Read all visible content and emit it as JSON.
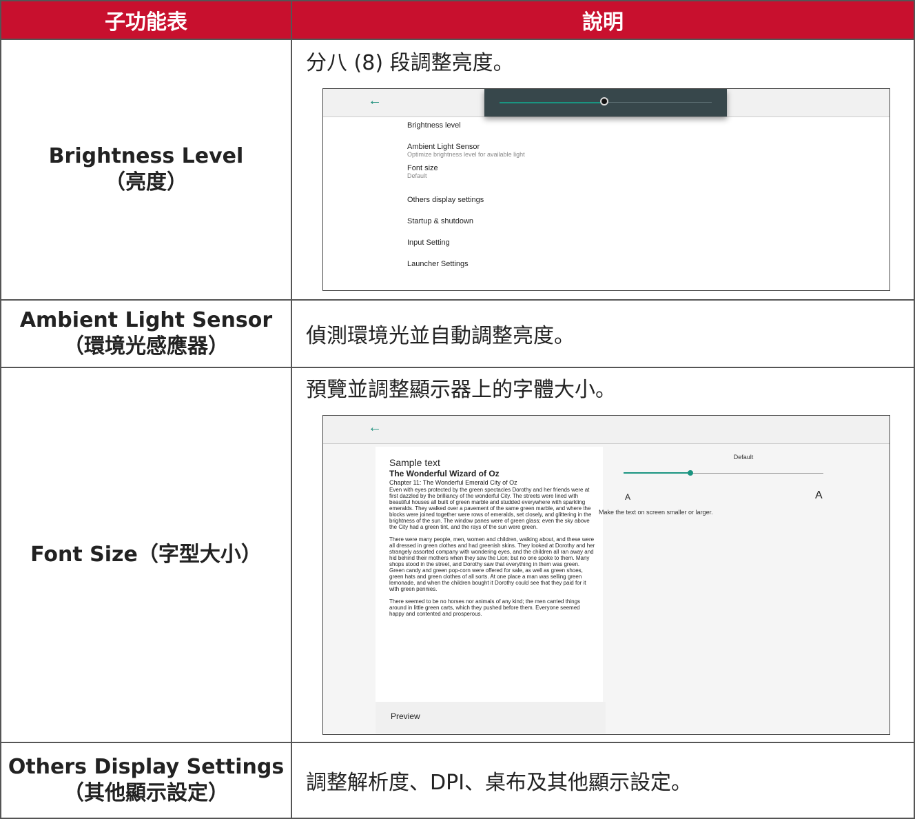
{
  "header": {
    "col1": "子功能表",
    "col2": "說明"
  },
  "rows": [
    {
      "name": "Brightness Level",
      "name_cn": "（亮度）",
      "desc": "分八 (8) 段調整亮度。",
      "screen": {
        "back_icon": "back-arrow-icon",
        "brightness_level": 0.47,
        "items": [
          {
            "label": "Brightness level",
            "sub": ""
          },
          {
            "label": "Ambient Light Sensor",
            "sub": "Optimize brightness level for available light"
          },
          {
            "label": "Font size",
            "sub": "Default"
          },
          {
            "label": "Others display settings",
            "sub": ""
          },
          {
            "label": "Startup & shutdown",
            "sub": ""
          },
          {
            "label": "Input Setting",
            "sub": ""
          },
          {
            "label": "Launcher Settings",
            "sub": ""
          }
        ]
      }
    },
    {
      "name": "Ambient Light Sensor",
      "name_cn": "（環境光感應器）",
      "desc": "偵測環境光並自動調整亮度。"
    },
    {
      "name": "Font Size（字型大小）",
      "desc": "預覽並調整顯示器上的字體大小。",
      "screen": {
        "sample_title": "Sample text",
        "book_title": "The Wonderful Wizard of Oz",
        "chapter": "Chapter 11: The Wonderful Emerald City of Oz",
        "paragraphs": [
          "Even with eyes protected by the green spectacles Dorothy and her friends were at first dazzled by the brilliancy of the wonderful City. The streets were lined with beautiful houses all built of green marble and studded everywhere with sparkling emeralds. They walked over a pavement of the same green marble, and where the blocks were joined together were rows of emeralds, set closely, and glittering in the brightness of the sun. The window panes were of green glass; even the sky above the City had a green tint, and the rays of the sun were green.",
          "There were many people, men, women and children, walking about, and these were all dressed in green clothes and had greenish skins. They looked at Dorothy and her strangely assorted company with wondering eyes, and the children all ran away and hid behind their mothers when they saw the Lion; but no one spoke to them. Many shops stood in the street, and Dorothy saw that everything in them was green. Green candy and green pop-corn were offered for sale, as well as green shoes, green hats and green clothes of all sorts. At one place a man was selling green lemonade, and when the children bought it Dorothy could see that they paid for it with green pennies.",
          "There seemed to be no horses nor animals of any kind; the men carried things around in little green carts, which they pushed before them. Everyone seemed happy and contented and prosperous."
        ],
        "preview_label": "Preview",
        "size_label": "Default",
        "size_level": 0.33,
        "small_a": "A",
        "large_a": "A",
        "help_text": "Make the text on screen smaller or larger."
      }
    },
    {
      "name": "Others Display Settings",
      "name_cn": "（其他顯示設定）",
      "desc": "調整解析度、DPI、桌布及其他顯示設定。"
    }
  ],
  "colors": {
    "header_bg": "#c8102e",
    "accent": "#1a9480"
  }
}
